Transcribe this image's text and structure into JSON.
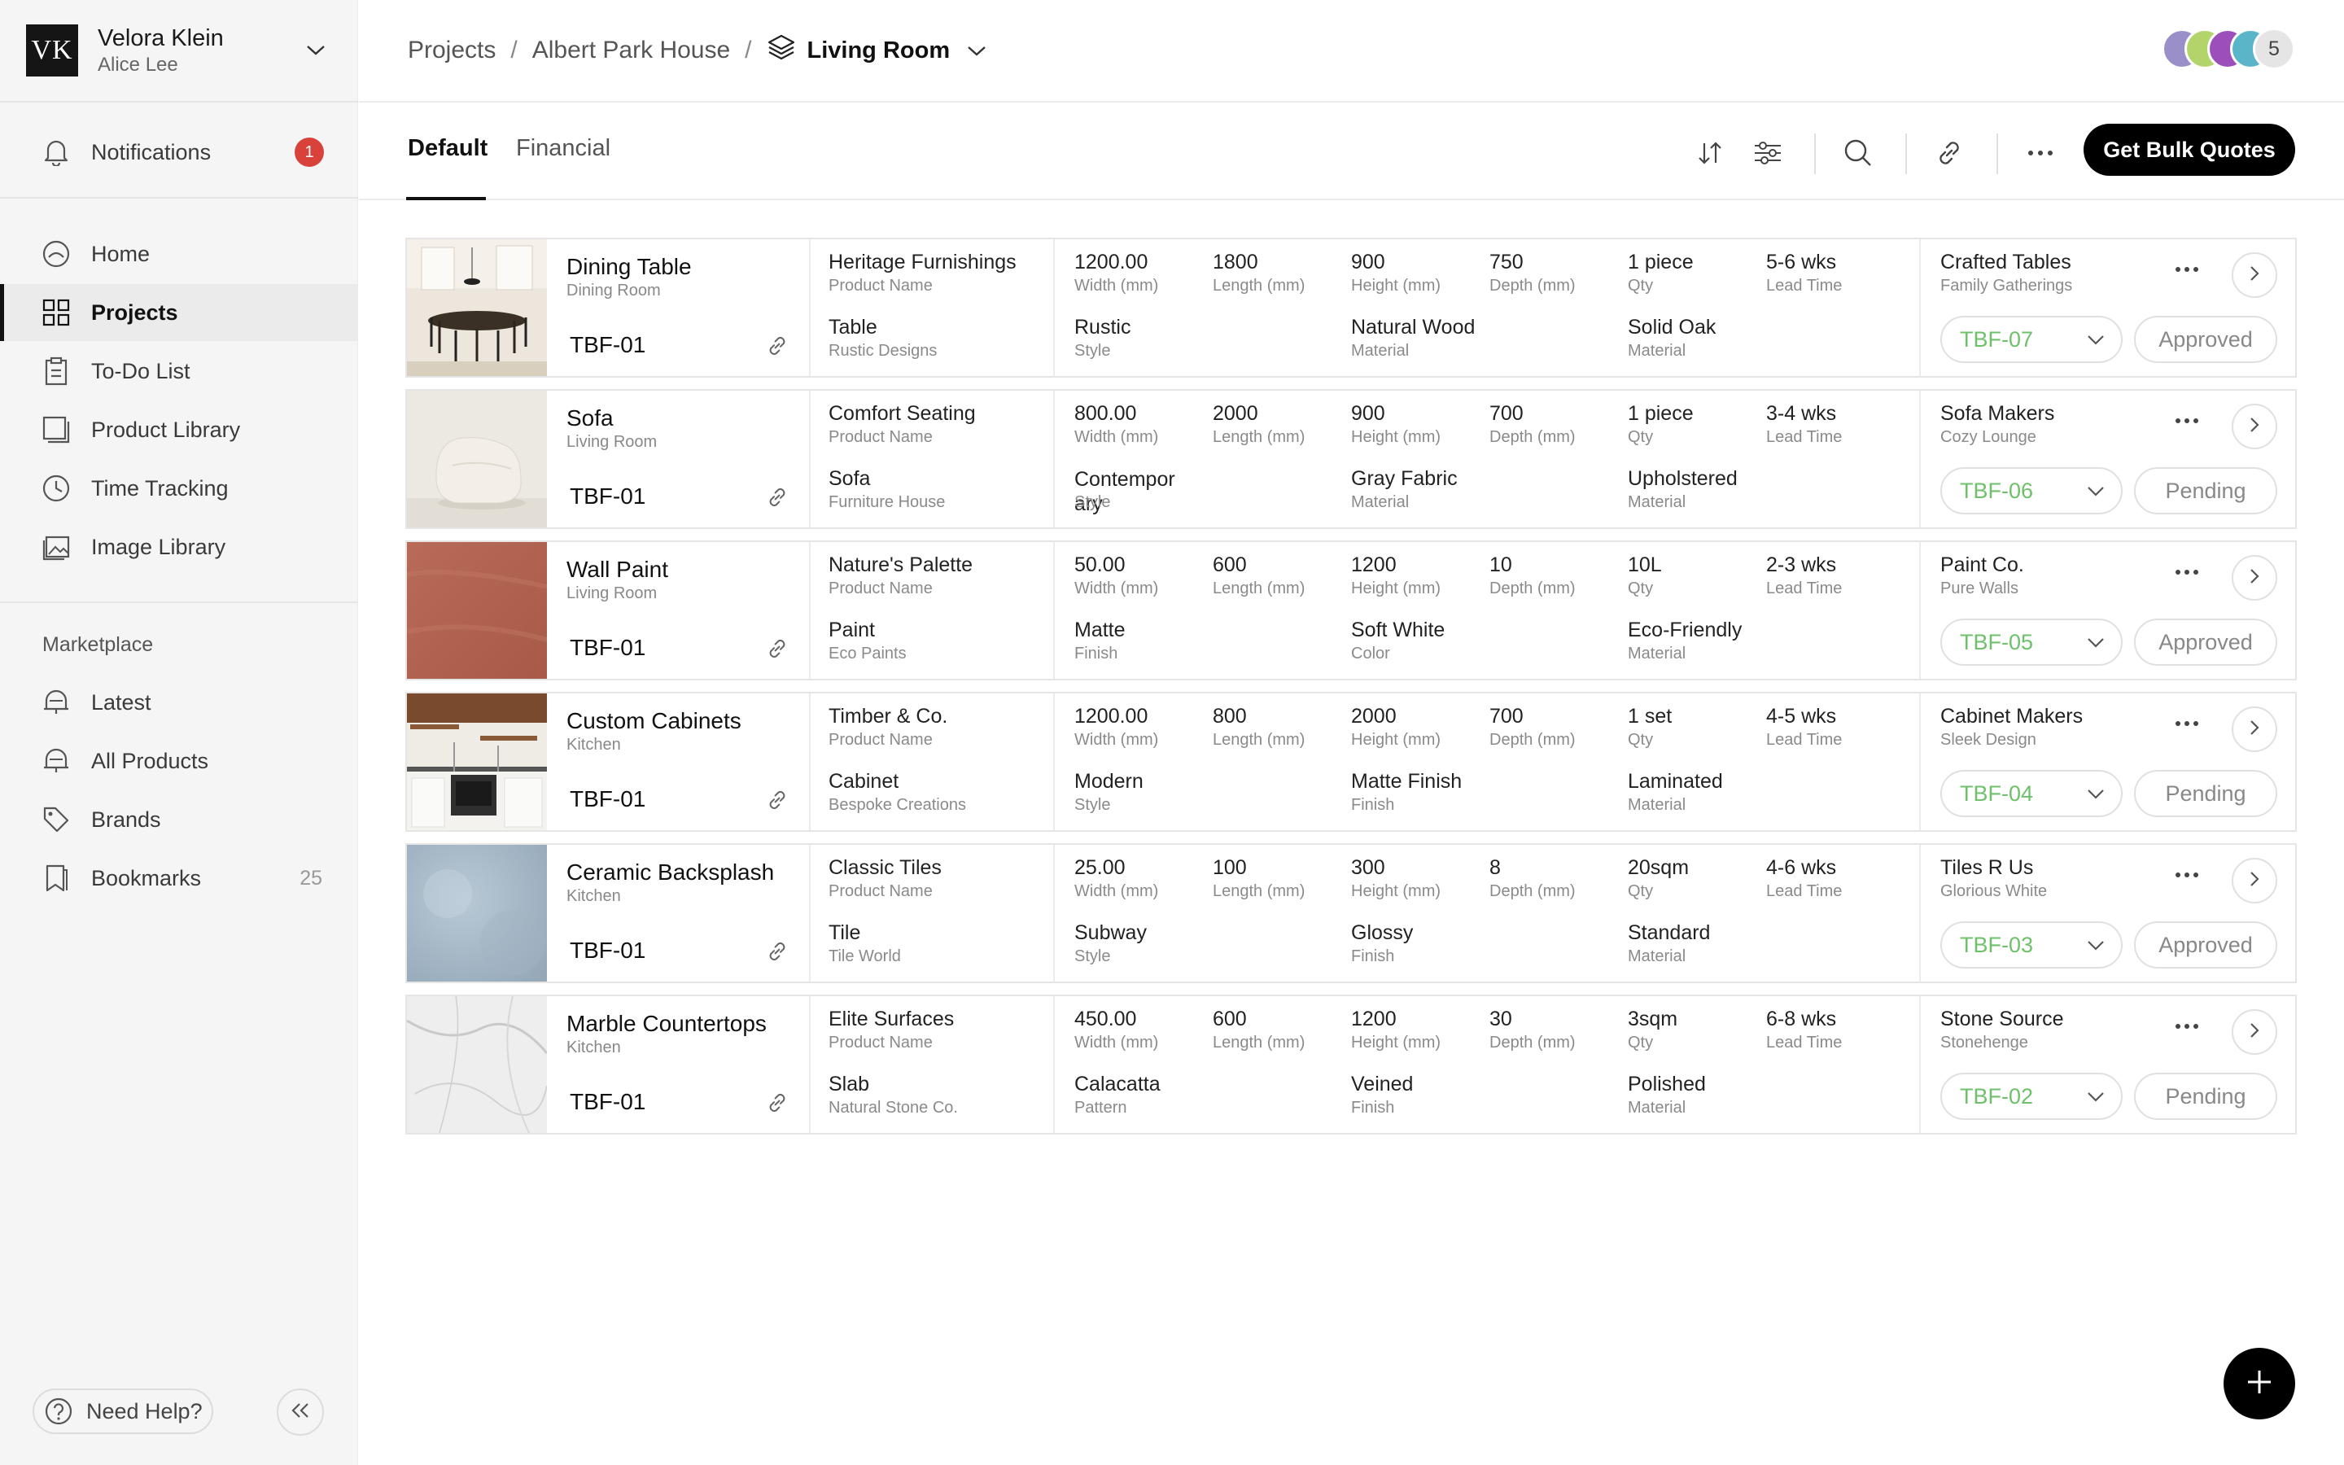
{
  "user": {
    "initials": "VK",
    "name": "Velora Klein",
    "subtitle": "Alice Lee"
  },
  "sidebar": {
    "notifications": {
      "label": "Notifications",
      "badge": "1"
    },
    "items": [
      {
        "label": "Home",
        "icon": "home-icon"
      },
      {
        "label": "Projects",
        "icon": "grid-icon"
      },
      {
        "label": "To-Do List",
        "icon": "clipboard-icon"
      },
      {
        "label": "Product Library",
        "icon": "library-icon"
      },
      {
        "label": "Time Tracking",
        "icon": "clock-icon"
      },
      {
        "label": "Image Library",
        "icon": "image-icon"
      }
    ],
    "marketplace_label": "Marketplace",
    "marketplace_items": [
      {
        "label": "Latest",
        "icon": "bell-shop-icon"
      },
      {
        "label": "All Products",
        "icon": "bell-shop-icon"
      },
      {
        "label": "Brands",
        "icon": "tag-icon"
      },
      {
        "label": "Bookmarks",
        "icon": "bookmark-icon",
        "count": "25"
      }
    ],
    "help_label": "Need Help?"
  },
  "breadcrumb": {
    "projects": "Projects",
    "project": "Albert Park House",
    "current": "Living Room"
  },
  "avatars": {
    "count": "5",
    "colors": [
      "#9a8fc9",
      "#b3d46a",
      "#9c4fb8",
      "#5bb5c9"
    ]
  },
  "tabs": [
    {
      "label": "Default"
    },
    {
      "label": "Financial"
    }
  ],
  "toolbar": {
    "bulk_label": "Get Bulk Quotes"
  },
  "rows": [
    {
      "name": "Dining Table",
      "room": "Dining Room",
      "code": "TBF-01",
      "product": {
        "v1": "Heritage Furnishings",
        "l1": "Product Name",
        "v2": "Table",
        "l2": "Rustic Designs"
      },
      "dims": [
        {
          "v": "1200.00",
          "l": "Width (mm)"
        },
        {
          "v": "1800",
          "l": "Length (mm)"
        },
        {
          "v": "900",
          "l": "Height (mm)"
        },
        {
          "v": "750",
          "l": "Depth (mm)"
        },
        {
          "v": "1 piece",
          "l": "Qty"
        },
        {
          "v": "5-6 wks",
          "l": "Lead Time"
        }
      ],
      "attrs": [
        {
          "v": "Rustic",
          "l": "Style"
        },
        {
          "v": "Natural Wood",
          "l": "Material"
        },
        {
          "v": "Solid Oak",
          "l": "Material"
        }
      ],
      "supplier": {
        "name": "Crafted Tables",
        "sub": "Family Gatherings",
        "ref": "TBF-07",
        "status": "Approved"
      }
    },
    {
      "name": "Sofa",
      "room": "Living Room",
      "code": "TBF-01",
      "product": {
        "v1": "Comfort Seating",
        "l1": "Product Name",
        "v2": "Sofa",
        "l2": "Furniture House"
      },
      "dims": [
        {
          "v": "800.00",
          "l": "Width (mm)"
        },
        {
          "v": "2000",
          "l": "Length (mm)"
        },
        {
          "v": "900",
          "l": "Height (mm)"
        },
        {
          "v": "700",
          "l": "Depth (mm)"
        },
        {
          "v": "1 piece",
          "l": "Qty"
        },
        {
          "v": "3-4 wks",
          "l": "Lead Time"
        }
      ],
      "attrs": [
        {
          "v": "Contempor ary",
          "l": "Style"
        },
        {
          "v": "Gray Fabric",
          "l": "Material"
        },
        {
          "v": "Upholstered",
          "l": "Material"
        }
      ],
      "supplier": {
        "name": "Sofa Makers",
        "sub": "Cozy Lounge",
        "ref": "TBF-06",
        "status": "Pending"
      }
    },
    {
      "name": "Wall Paint",
      "room": "Living Room",
      "code": "TBF-01",
      "product": {
        "v1": "Nature's Palette",
        "l1": "Product Name",
        "v2": "Paint",
        "l2": "Eco Paints"
      },
      "dims": [
        {
          "v": "50.00",
          "l": "Width (mm)"
        },
        {
          "v": "600",
          "l": "Length (mm)"
        },
        {
          "v": "1200",
          "l": "Height (mm)"
        },
        {
          "v": "10",
          "l": "Depth (mm)"
        },
        {
          "v": "10L",
          "l": "Qty"
        },
        {
          "v": "2-3 wks",
          "l": "Lead Time"
        }
      ],
      "attrs": [
        {
          "v": "Matte",
          "l": "Finish"
        },
        {
          "v": "Soft White",
          "l": "Color"
        },
        {
          "v": "Eco-Friendly",
          "l": "Material"
        }
      ],
      "supplier": {
        "name": "Paint Co.",
        "sub": "Pure Walls",
        "ref": "TBF-05",
        "status": "Approved"
      }
    },
    {
      "name": "Custom Cabinets",
      "room": "Kitchen",
      "code": "TBF-01",
      "product": {
        "v1": "Timber & Co.",
        "l1": "Product Name",
        "v2": "Cabinet",
        "l2": "Bespoke Creations"
      },
      "dims": [
        {
          "v": "1200.00",
          "l": "Width (mm)"
        },
        {
          "v": "800",
          "l": "Length (mm)"
        },
        {
          "v": "2000",
          "l": "Height (mm)"
        },
        {
          "v": "700",
          "l": "Depth (mm)"
        },
        {
          "v": "1 set",
          "l": "Qty"
        },
        {
          "v": "4-5 wks",
          "l": "Lead Time"
        }
      ],
      "attrs": [
        {
          "v": "Modern",
          "l": "Style"
        },
        {
          "v": "Matte Finish",
          "l": "Finish"
        },
        {
          "v": "Laminated",
          "l": "Material"
        }
      ],
      "supplier": {
        "name": "Cabinet Makers",
        "sub": "Sleek Design",
        "ref": "TBF-04",
        "status": "Pending"
      }
    },
    {
      "name": "Ceramic Backsplash",
      "room": "Kitchen",
      "code": "TBF-01",
      "product": {
        "v1": "Classic Tiles",
        "l1": "Product Name",
        "v2": "Tile",
        "l2": "Tile World"
      },
      "dims": [
        {
          "v": "25.00",
          "l": "Width (mm)"
        },
        {
          "v": "100",
          "l": "Length (mm)"
        },
        {
          "v": "300",
          "l": "Height (mm)"
        },
        {
          "v": "8",
          "l": "Depth (mm)"
        },
        {
          "v": "20sqm",
          "l": "Qty"
        },
        {
          "v": "4-6 wks",
          "l": "Lead Time"
        }
      ],
      "attrs": [
        {
          "v": "Subway",
          "l": "Style"
        },
        {
          "v": "Glossy",
          "l": "Finish"
        },
        {
          "v": "Standard",
          "l": "Material"
        }
      ],
      "supplier": {
        "name": "Tiles R Us",
        "sub": "Glorious White",
        "ref": "TBF-03",
        "status": "Approved"
      }
    },
    {
      "name": "Marble Countertops",
      "room": "Kitchen",
      "code": "TBF-01",
      "product": {
        "v1": "Elite Surfaces",
        "l1": "Product Name",
        "v2": "Slab",
        "l2": "Natural Stone Co."
      },
      "dims": [
        {
          "v": "450.00",
          "l": "Width (mm)"
        },
        {
          "v": "600",
          "l": "Length (mm)"
        },
        {
          "v": "1200",
          "l": "Height (mm)"
        },
        {
          "v": "30",
          "l": "Depth (mm)"
        },
        {
          "v": "3sqm",
          "l": "Qty"
        },
        {
          "v": "6-8 wks",
          "l": "Lead Time"
        }
      ],
      "attrs": [
        {
          "v": "Calacatta",
          "l": "Pattern"
        },
        {
          "v": "Veined",
          "l": "Finish"
        },
        {
          "v": "Polished",
          "l": "Material"
        }
      ],
      "supplier": {
        "name": "Stone Source",
        "sub": "Stonehenge",
        "ref": "TBF-02",
        "status": "Pending"
      }
    }
  ]
}
